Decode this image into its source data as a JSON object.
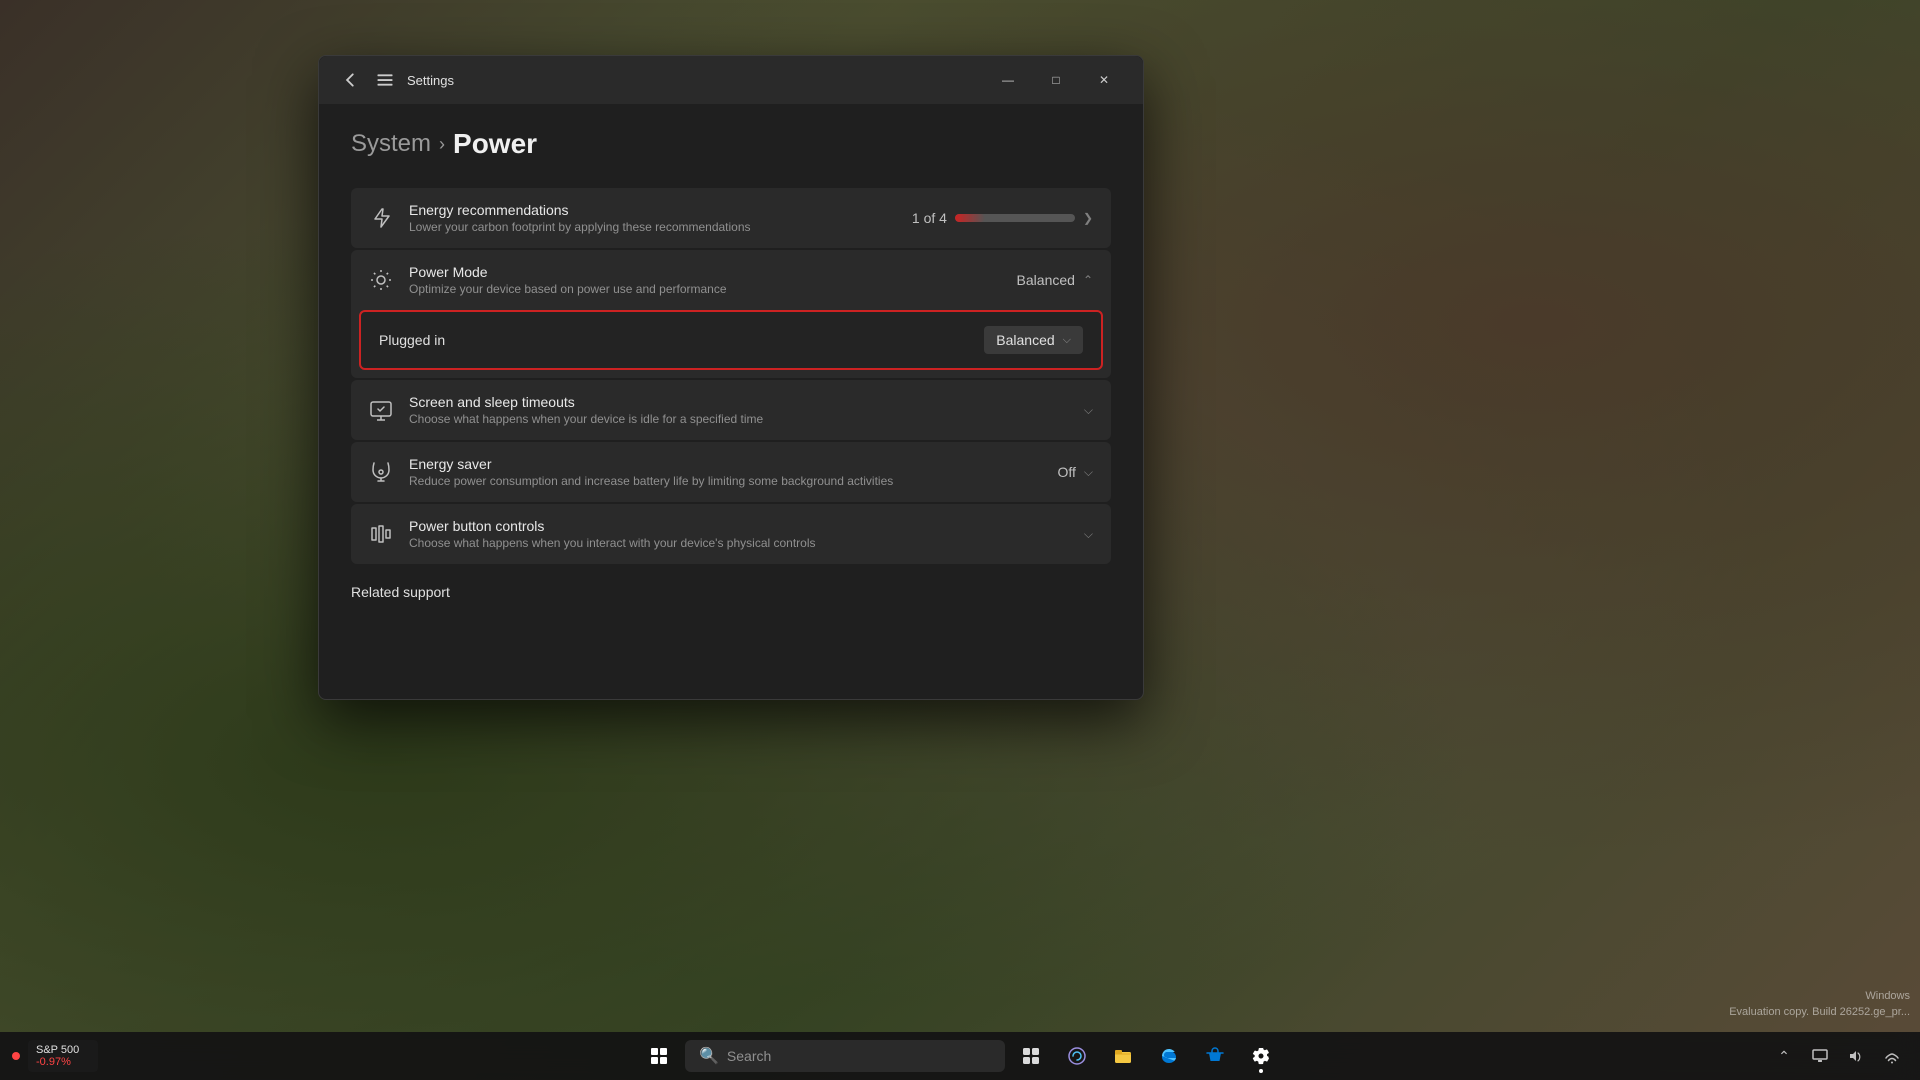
{
  "window": {
    "title": "Settings",
    "breadcrumb_parent": "System",
    "breadcrumb_separator": "›",
    "breadcrumb_current": "Power"
  },
  "settings": {
    "energy_recommendations": {
      "title": "Energy recommendations",
      "desc": "Lower your carbon footprint by applying these recommendations",
      "progress_label": "1 of 4",
      "progress_percent": 25
    },
    "power_mode": {
      "title": "Power Mode",
      "desc": "Optimize your device based on power use and performance",
      "value": "Balanced",
      "expanded": true,
      "plugged_in": {
        "label": "Plugged in",
        "value": "Balanced",
        "highlighted": true
      }
    },
    "screen_sleep": {
      "title": "Screen and sleep timeouts",
      "desc": "Choose what happens when your device is idle for a specified time"
    },
    "energy_saver": {
      "title": "Energy saver",
      "desc": "Reduce power consumption and increase battery life by limiting some background activities",
      "value": "Off"
    },
    "power_button": {
      "title": "Power button controls",
      "desc": "Choose what happens when you interact with your device's physical controls"
    }
  },
  "related_support": {
    "label": "Related support"
  },
  "taskbar": {
    "start_icon": "⊞",
    "search_placeholder": "Search",
    "icons": [
      {
        "name": "widgets",
        "glyph": "🎲"
      },
      {
        "name": "browser",
        "glyph": "🌐"
      },
      {
        "name": "store",
        "glyph": "🛍"
      },
      {
        "name": "settings",
        "glyph": "⚙"
      }
    ],
    "stock": {
      "name": "S&P 500",
      "change": "-0.97%"
    }
  },
  "watermark": {
    "line1": "Windows",
    "line2": "Evaluation copy. Build 26252.ge_pr..."
  }
}
